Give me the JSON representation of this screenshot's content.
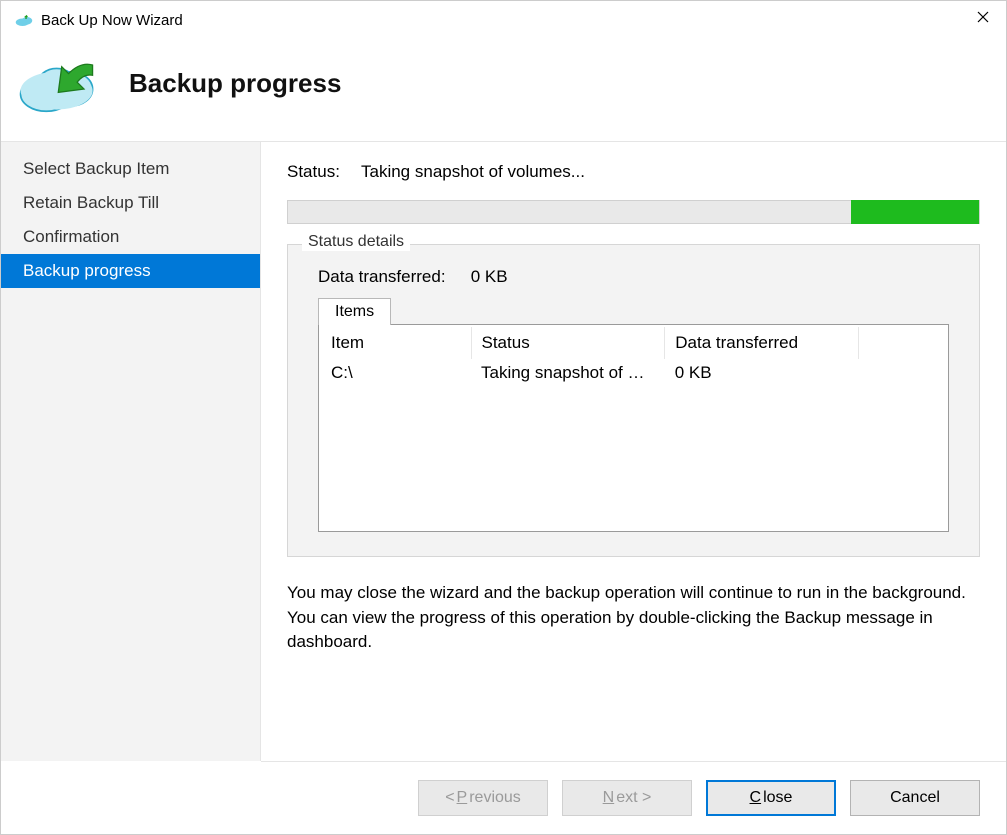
{
  "window": {
    "title": "Back Up Now Wizard"
  },
  "header": {
    "title": "Backup progress"
  },
  "sidebar": {
    "steps": [
      "Select Backup Item",
      "Retain Backup Till",
      "Confirmation",
      "Backup progress"
    ],
    "active_index": 3
  },
  "status": {
    "label": "Status:",
    "value": "Taking snapshot of volumes..."
  },
  "details": {
    "legend": "Status details",
    "transferred_label": "Data transferred:",
    "transferred_value": "0 KB",
    "tab_label": "Items",
    "columns": [
      "Item",
      "Status",
      "Data transferred"
    ],
    "rows": [
      {
        "item": "C:\\",
        "status": "Taking snapshot of …",
        "transferred": "0 KB"
      }
    ]
  },
  "note": "You may close the wizard and the backup operation will continue to run in the background. You can view the progress of this operation by double-clicking the Backup message in dashboard.",
  "buttons": {
    "previous": {
      "pre": "< ",
      "mnemonic": "P",
      "post": "revious"
    },
    "next": {
      "mnemonic": "N",
      "post": "ext >"
    },
    "close": {
      "mnemonic": "C",
      "post": "lose"
    },
    "cancel": {
      "label": "Cancel"
    }
  }
}
